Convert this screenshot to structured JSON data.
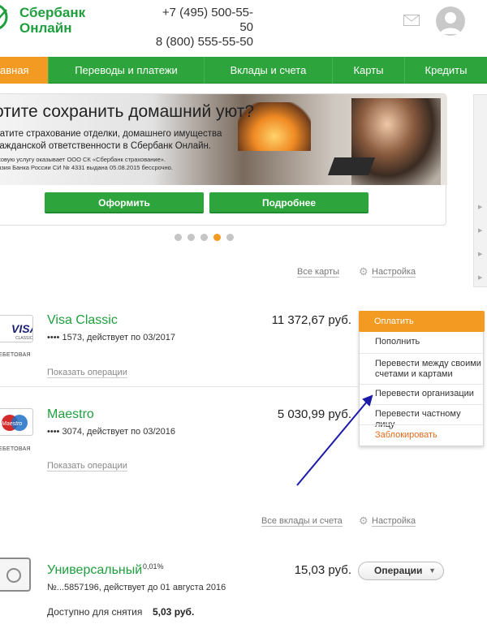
{
  "header": {
    "logo_line1": "Сбербанк",
    "logo_line2": "Онлайн",
    "phone1": "+7 (495) 500-55-50",
    "phone2": "8 (800) 555-55-50",
    "mail_icon": "envelope-icon",
    "avatar_icon": "user-avatar-icon"
  },
  "nav": {
    "items": [
      {
        "label": "авная",
        "active": true
      },
      {
        "label": "Переводы и платежи"
      },
      {
        "label": "Вклады и счета"
      },
      {
        "label": "Карты"
      },
      {
        "label": "Кредиты"
      }
    ]
  },
  "banner": {
    "title": "отите сохранить домашний уют?",
    "sub1": "латите страхование отделки, домашнего имущества",
    "sub2": "ражданской ответственности в Сбербанк Онлайн.",
    "small1": "аховую услугу оказывает ООО СК «Сбербанк страхование».",
    "small2": "ензия Банка России СИ № 4331 выдана 05.08.2015 бессрочно.",
    "btn_primary": "Оформить",
    "btn_secondary": "Подробнее",
    "slides": 5,
    "active_slide": 4
  },
  "cards_section": {
    "all_link": "Все карты",
    "settings_link": "Настройка",
    "cards": [
      {
        "brand": "VISA",
        "brand_sub": "CLASSIC",
        "type": "ЕБЕТОВАЯ",
        "name": "Visa Classic",
        "detail": "•••• 1573, действует по 03/2017",
        "amount": "11 372,67 руб.",
        "ops": "Показать операции"
      },
      {
        "brand": "Maestro",
        "type": "ЕБЕТОВАЯ",
        "name": "Maestro",
        "detail": "•••• 3074, действует по 03/2016",
        "amount": "5 030,99 руб.",
        "ops": "Показать операции"
      }
    ]
  },
  "dropdown": {
    "head": "Оплатить",
    "items": [
      "Пополнить",
      "Перевести между своими",
      "счетами и картами",
      "Перевести организации",
      "Перевести частному лицу",
      "Заблокировать"
    ]
  },
  "deposits_section": {
    "all_link": "Все вклады и счета",
    "settings_link": "Настройка",
    "name": "Универсальный",
    "rate": "0,01%",
    "detail": "№...5857196, действует до 01 августа 2016",
    "amount": "15,03 руб.",
    "ops_button": "Операции",
    "available_label": "Доступно для снятия",
    "available_value": "5,03 руб."
  },
  "colors": {
    "brand_green": "#1f9e3e",
    "nav_green": "#2da53c",
    "accent_orange": "#f39a22",
    "arrow_blue": "#1c1aa8"
  }
}
